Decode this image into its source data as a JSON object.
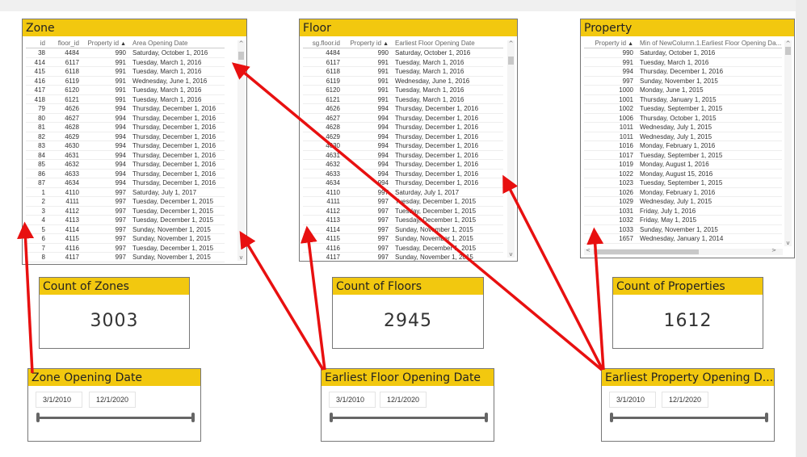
{
  "zone": {
    "title": "Zone",
    "columns": [
      "id",
      "floor_id",
      "Property id",
      "Area Opening Date"
    ],
    "rows": [
      [
        "38",
        "4484",
        "990",
        "Saturday, October 1, 2016"
      ],
      [
        "414",
        "6117",
        "991",
        "Tuesday, March 1, 2016"
      ],
      [
        "415",
        "6118",
        "991",
        "Tuesday, March 1, 2016"
      ],
      [
        "416",
        "6119",
        "991",
        "Wednesday, June 1, 2016"
      ],
      [
        "417",
        "6120",
        "991",
        "Tuesday, March 1, 2016"
      ],
      [
        "418",
        "6121",
        "991",
        "Tuesday, March 1, 2016"
      ],
      [
        "79",
        "4626",
        "994",
        "Thursday, December 1, 2016"
      ],
      [
        "80",
        "4627",
        "994",
        "Thursday, December 1, 2016"
      ],
      [
        "81",
        "4628",
        "994",
        "Thursday, December 1, 2016"
      ],
      [
        "82",
        "4629",
        "994",
        "Thursday, December 1, 2016"
      ],
      [
        "83",
        "4630",
        "994",
        "Thursday, December 1, 2016"
      ],
      [
        "84",
        "4631",
        "994",
        "Thursday, December 1, 2016"
      ],
      [
        "85",
        "4632",
        "994",
        "Thursday, December 1, 2016"
      ],
      [
        "86",
        "4633",
        "994",
        "Thursday, December 1, 2016"
      ],
      [
        "87",
        "4634",
        "994",
        "Thursday, December 1, 2016"
      ],
      [
        "1",
        "4110",
        "997",
        "Saturday, July 1, 2017"
      ],
      [
        "2",
        "4111",
        "997",
        "Tuesday, December 1, 2015"
      ],
      [
        "3",
        "4112",
        "997",
        "Tuesday, December 1, 2015"
      ],
      [
        "4",
        "4113",
        "997",
        "Tuesday, December 1, 2015"
      ],
      [
        "5",
        "4114",
        "997",
        "Sunday, November 1, 2015"
      ],
      [
        "6",
        "4115",
        "997",
        "Sunday, November 1, 2015"
      ],
      [
        "7",
        "4116",
        "997",
        "Tuesday, December 1, 2015"
      ],
      [
        "8",
        "4117",
        "997",
        "Sunday, November 1, 2015"
      ]
    ]
  },
  "floor": {
    "title": "Floor",
    "columns": [
      "sg.floor.id",
      "Property id",
      "Earliest Floor Opening Date"
    ],
    "rows": [
      [
        "4484",
        "990",
        "Saturday, October 1, 2016"
      ],
      [
        "6117",
        "991",
        "Tuesday, March 1, 2016"
      ],
      [
        "6118",
        "991",
        "Tuesday, March 1, 2016"
      ],
      [
        "6119",
        "991",
        "Wednesday, June 1, 2016"
      ],
      [
        "6120",
        "991",
        "Tuesday, March 1, 2016"
      ],
      [
        "6121",
        "991",
        "Tuesday, March 1, 2016"
      ],
      [
        "4626",
        "994",
        "Thursday, December 1, 2016"
      ],
      [
        "4627",
        "994",
        "Thursday, December 1, 2016"
      ],
      [
        "4628",
        "994",
        "Thursday, December 1, 2016"
      ],
      [
        "4629",
        "994",
        "Thursday, December 1, 2016"
      ],
      [
        "4630",
        "994",
        "Thursday, December 1, 2016"
      ],
      [
        "4631",
        "994",
        "Thursday, December 1, 2016"
      ],
      [
        "4632",
        "994",
        "Thursday, December 1, 2016"
      ],
      [
        "4633",
        "994",
        "Thursday, December 1, 2016"
      ],
      [
        "4634",
        "994",
        "Thursday, December 1, 2016"
      ],
      [
        "4110",
        "997",
        "Saturday, July 1, 2017"
      ],
      [
        "4111",
        "997",
        "Tuesday, December 1, 2015"
      ],
      [
        "4112",
        "997",
        "Tuesday, December 1, 2015"
      ],
      [
        "4113",
        "997",
        "Tuesday, December 1, 2015"
      ],
      [
        "4114",
        "997",
        "Sunday, November 1, 2015"
      ],
      [
        "4115",
        "997",
        "Sunday, November 1, 2015"
      ],
      [
        "4116",
        "997",
        "Tuesday, December 1, 2015"
      ],
      [
        "4117",
        "997",
        "Sunday, November 1, 2015"
      ]
    ]
  },
  "property": {
    "title": "Property",
    "columns": [
      "Property id",
      "Min of NewColumn.1.Earliest Floor Opening Da..."
    ],
    "rows": [
      [
        "990",
        "Saturday, October 1, 2016"
      ],
      [
        "991",
        "Tuesday, March 1, 2016"
      ],
      [
        "994",
        "Thursday, December 1, 2016"
      ],
      [
        "997",
        "Sunday, November 1, 2015"
      ],
      [
        "1000",
        "Monday, June 1, 2015"
      ],
      [
        "1001",
        "Thursday, January 1, 2015"
      ],
      [
        "1002",
        "Tuesday, September 1, 2015"
      ],
      [
        "1006",
        "Thursday, October 1, 2015"
      ],
      [
        "1011",
        "Wednesday, July 1, 2015"
      ],
      [
        "1011",
        "Wednesday, July 1, 2015"
      ],
      [
        "1016",
        "Monday, February 1, 2016"
      ],
      [
        "1017",
        "Tuesday, September 1, 2015"
      ],
      [
        "1019",
        "Monday, August 1, 2016"
      ],
      [
        "1022",
        "Monday, August 15, 2016"
      ],
      [
        "1023",
        "Tuesday, September 1, 2015"
      ],
      [
        "1026",
        "Monday, February 1, 2016"
      ],
      [
        "1029",
        "Wednesday, July 1, 2015"
      ],
      [
        "1031",
        "Friday, July 1, 2016"
      ],
      [
        "1032",
        "Friday, May 1, 2015"
      ],
      [
        "1033",
        "Sunday, November 1, 2015"
      ],
      [
        "1657",
        "Wednesday, January 1, 2014"
      ]
    ]
  },
  "cards": [
    {
      "title": "Count of Zones",
      "value": "3003"
    },
    {
      "title": "Count of Floors",
      "value": "2945"
    },
    {
      "title": "Count of Properties",
      "value": "1612"
    }
  ],
  "slicers": [
    {
      "title": "Zone Opening Date",
      "start": "3/1/2010",
      "end": "12/1/2020"
    },
    {
      "title": "Earliest Floor Opening Date",
      "start": "3/1/2010",
      "end": "12/1/2020"
    },
    {
      "title": "Earliest Property Opening D...",
      "start": "3/1/2010",
      "end": "12/1/2020"
    }
  ],
  "sort_icon": "triangle-up",
  "scroll_up": "^",
  "scroll_down": "v",
  "scroll_left": "<",
  "scroll_right": ">",
  "colors": {
    "header": "#f2c80f",
    "arrow": "#e81010"
  }
}
